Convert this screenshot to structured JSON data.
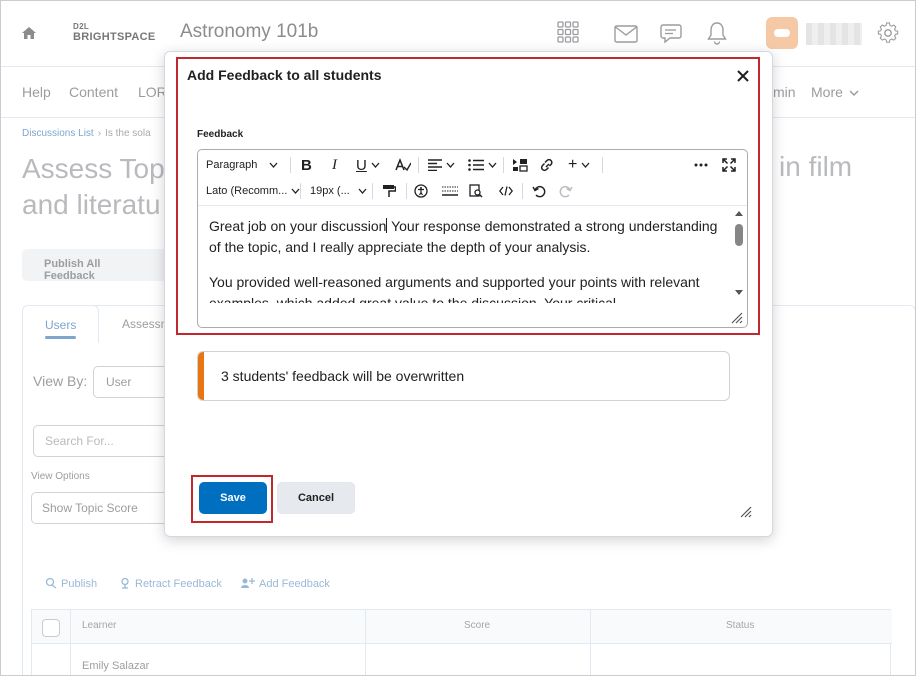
{
  "topbar": {
    "logo_small": "D2L",
    "logo_main": "BRIGHTSPACE",
    "course_title": "Astronomy 101b",
    "icons": [
      "home-icon",
      "apps-grid-icon",
      "mail-icon",
      "chat-icon",
      "bell-icon",
      "gear-icon"
    ]
  },
  "nav": {
    "items": [
      "Help",
      "Content",
      "LOR",
      "min",
      "More"
    ]
  },
  "breadcrumb": {
    "link": "Discussions List",
    "current": "Is the sola"
  },
  "page": {
    "title_left": "Assess Top and literatu",
    "title_right": "in film",
    "publish_all_label": "Publish All Feedback",
    "tab_users": "Users",
    "tab_assess": "Assessm",
    "view_by_label": "View By:",
    "view_by_value": "User",
    "search_placeholder": "Search For...",
    "view_options_label": "View Options",
    "view_options_value": "Show Topic Score",
    "actions": {
      "publish": "Publish",
      "retract": "Retract Feedback",
      "add": "Add Feedback"
    },
    "grid": {
      "columns": [
        "Learner",
        "Score",
        "Status"
      ],
      "rows": [
        "Emily Salazar"
      ]
    }
  },
  "modal": {
    "title": "Add Feedback to all students",
    "field_label": "Feedback",
    "toolbar": {
      "format": "Paragraph",
      "font": "Lato (Recomm...",
      "size": "19px (..."
    },
    "content": {
      "p1a": "Great job on your discussion",
      "p1b": " Your response demonstrated a strong understanding of the topic, and I really appreciate the depth of your analysis.",
      "p2": "You provided well-reasoned arguments and supported your points with relevant examples, which added great value to the discussion. Your critical"
    },
    "alert_text": "3 students' feedback will be overwritten",
    "save_label": "Save",
    "cancel_label": "Cancel"
  },
  "colors": {
    "primary": "#006fbf",
    "alert_accent": "#e87511",
    "highlight_box": "#c0282e"
  }
}
